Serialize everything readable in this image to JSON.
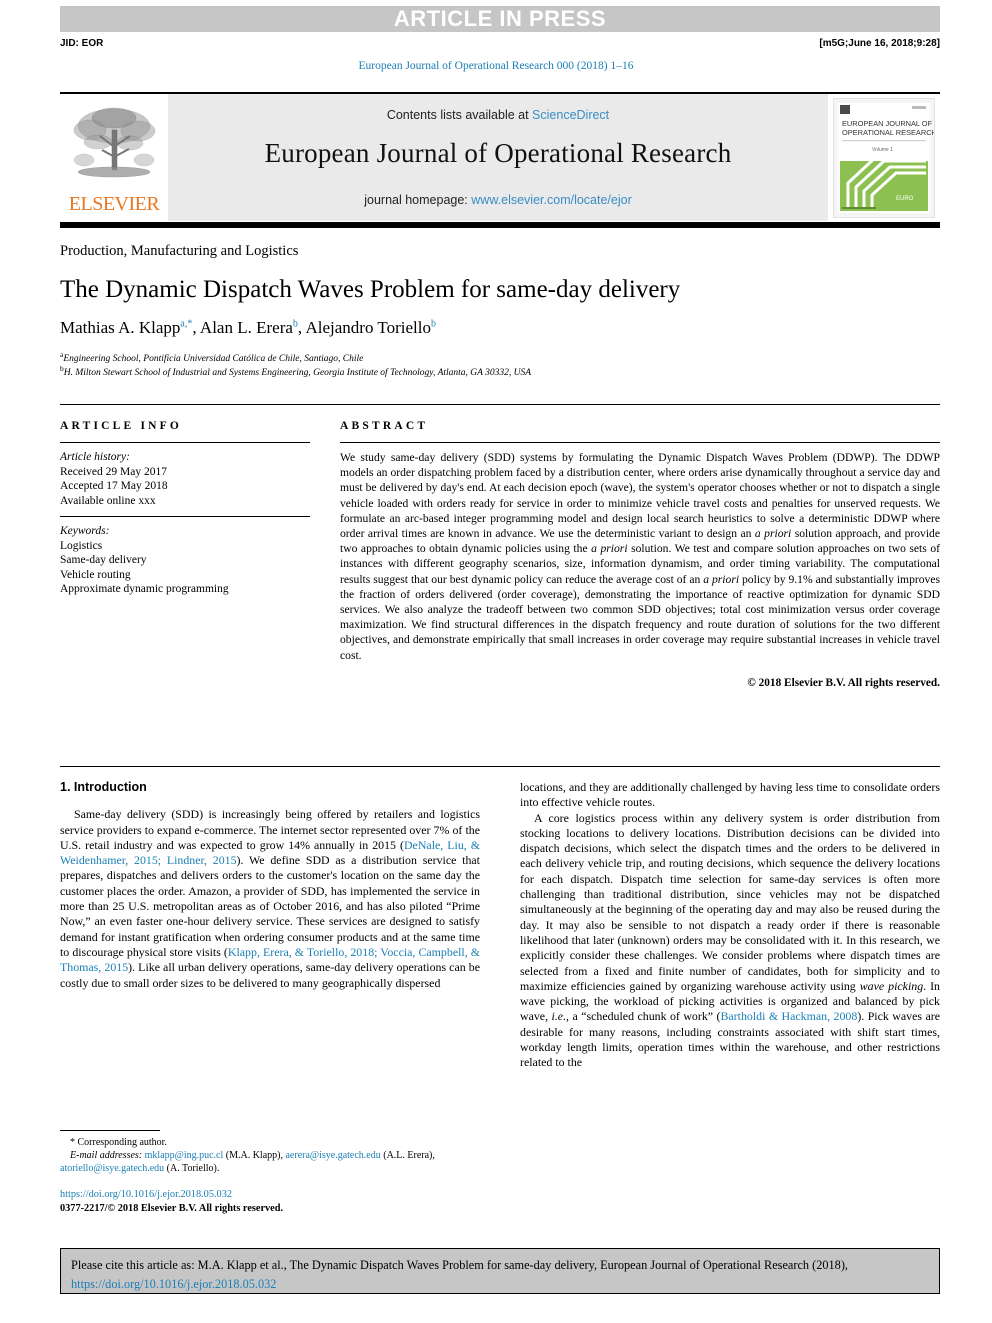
{
  "header": {
    "banner": "ARTICLE IN PRESS",
    "jid": "JID: EOR",
    "build_stamp": "[m5G;June 16, 2018;9:28]",
    "running_head": "European Journal of Operational Research 000 (2018) 1–16"
  },
  "masthead": {
    "contents_prefix": "Contents lists available at ",
    "sciencedirect": "ScienceDirect",
    "journal_title": "European Journal of Operational Research",
    "homepage_prefix": "journal homepage: ",
    "homepage_url": "www.elsevier.com/locate/ejor",
    "publisher_logo_text": "ELSEVIER",
    "cover_line1": "EUROPEAN JOURNAL OF",
    "cover_line2": "OPERATIONAL RESEARCH",
    "cover_volume": "Volume 1",
    "cover_footer": "EURO"
  },
  "article": {
    "section": "Production, Manufacturing and Logistics",
    "title": "The Dynamic Dispatch Waves Problem for same-day delivery",
    "authors_html": "Mathias A. Klapp<sup class=\"sup\">a,*</sup>, Alan L. Erera<sup class=\"sup\">b</sup>, Alejandro Toriello<sup class=\"sup\">b</sup>",
    "affiliation_a": "Engineering School, Pontificia Universidad Católica de Chile, Santiago, Chile",
    "affiliation_b": "H. Milton Stewart School of Industrial and Systems Engineering, Georgia Institute of Technology, Atlanta, GA 30332, USA",
    "affil_a_mark": "a",
    "affil_b_mark": "b"
  },
  "info": {
    "heading": "ARTICLE INFO",
    "history_label": "Article history:",
    "received": "Received 29 May 2017",
    "accepted": "Accepted 17 May 2018",
    "available": "Available online xxx",
    "keywords_label": "Keywords:",
    "keywords": [
      "Logistics",
      "Same-day delivery",
      "Vehicle routing",
      "Approximate dynamic programming"
    ]
  },
  "abstract": {
    "heading": "ABSTRACT",
    "text_html": "We study same-day delivery (SDD) systems by formulating the Dynamic Dispatch Waves Problem (DDWP). The DDWP models an order dispatching problem faced by a distribution center, where orders arise dynamically throughout a service day and must be delivered by day's end. At each decision epoch (wave), the system's operator chooses whether or not to dispatch a single vehicle loaded with orders ready for service in order to minimize vehicle travel costs and penalties for unserved requests. We formulate an arc-based integer programming model and design local search heuristics to solve a deterministic DDWP where order arrival times are known in advance. We use the deterministic variant to design an <i>a priori</i> solution approach, and provide two approaches to obtain dynamic policies using the <i>a priori</i> solution. We test and compare solution approaches on two sets of instances with different geography scenarios, size, information dynamism, and order timing variability. The computational results suggest that our best dynamic policy can reduce the average cost of an <i>a priori</i> policy by 9.1% and substantially improves the fraction of orders delivered (order coverage), demonstrating the importance of reactive optimization for dynamic SDD services. We also analyze the tradeoff between two common SDD objectives; total cost minimization versus order coverage maximization. We find structural differences in the dispatch frequency and route duration of solutions for the two different objectives, and demonstrate empirically that small increases in order coverage may require substantial increases in vehicle travel cost.",
    "copyright": "© 2018 Elsevier B.V. All rights reserved."
  },
  "body": {
    "section_heading": "1. Introduction",
    "left_paragraph_html": "Same-day delivery (SDD) is increasingly being offered by retailers and logistics service providers to expand e-commerce. The internet sector represented over 7% of the U.S. retail industry and was expected to grow 14% annually in 2015 (<span class=\"cite\">DeNale, Liu, &amp; Weidenhamer, 2015; Lindner, 2015</span>). We define SDD as a distribution service that prepares, dispatches and delivers orders to the customer's location on the same day the customer places the order. Amazon, a provider of SDD, has implemented the service in more than 25 U.S. metropolitan areas as of October 2016, and has also piloted “Prime Now,” an even faster one-hour delivery service. These services are designed to satisfy demand for instant gratification when ordering consumer products and at the same time to discourage physical store visits (<span class=\"cite\">Klapp, Erera, &amp; Toriello, 2018; Voccia, Campbell, &amp; Thomas, 2015</span>). Like all urban delivery operations, same-day delivery operations can be costly due to small order sizes to be delivered to many geographically dispersed",
    "right_paragraph_1_html": "locations, and they are additionally challenged by having less time to consolidate orders into effective vehicle routes.",
    "right_paragraph_2_html": "A core logistics process within any delivery system is order distribution from stocking locations to delivery locations. Distribution decisions can be divided into dispatch decisions, which select the dispatch times and the orders to be delivered in each delivery vehicle trip, and routing decisions, which sequence the delivery locations for each dispatch. Dispatch time selection for same-day services is often more challenging than traditional distribution, since vehicles may not be dispatched simultaneously at the beginning of the operating day and may also be reused during the day. It may also be sensible to not dispatch a ready order if there is reasonable likelihood that later (unknown) orders may be consolidated with it. In this research, we explicitly consider these challenges. We consider problems where dispatch times are selected from a fixed and finite number of candidates, both for simplicity and to maximize efficiencies gained by organizing warehouse activity using <em class=\"it\">wave picking</em>. In wave picking, the workload of picking activities is organized and balanced by pick wave, <em class=\"it\">i.e.</em>, a “scheduled chunk of work” (<span class=\"cite\">Bartholdi &amp; Hackman, 2008</span>). Pick waves are desirable for many reasons, including constraints associated with shift start times, workday length limits, operation times within the warehouse, and other restrictions related to the"
  },
  "footnote": {
    "corresponding": "* Corresponding author.",
    "email_html": "<em>E-mail addresses:</em> <span class=\"link\">mklapp@ing.puc.cl</span> (M.A. Klapp), <span class=\"link\">aerera@isye.gatech.edu</span> (A.L. Erera), <span class=\"link\">atoriello@isye.gatech.edu</span> (A. Toriello).",
    "doi": "https://doi.org/10.1016/j.ejor.2018.05.032",
    "issn_line": "0377-2217/© 2018 Elsevier B.V. All rights reserved."
  },
  "citation_box": {
    "text_prefix": "Please cite this article as: M.A. Klapp et al., The Dynamic Dispatch Waves Problem for same-day delivery, European Journal of Operational Research (2018), ",
    "doi_link": "https://doi.org/10.1016/j.ejor.2018.05.032"
  },
  "colors": {
    "link": "#1a7fb5",
    "sciencedirect": "#3a8dc4",
    "elsevier_orange": "#e87722",
    "banner_gray": "#c6c6c6",
    "masthead_gray": "#eaeaea",
    "cover_green": "#7cb342"
  }
}
